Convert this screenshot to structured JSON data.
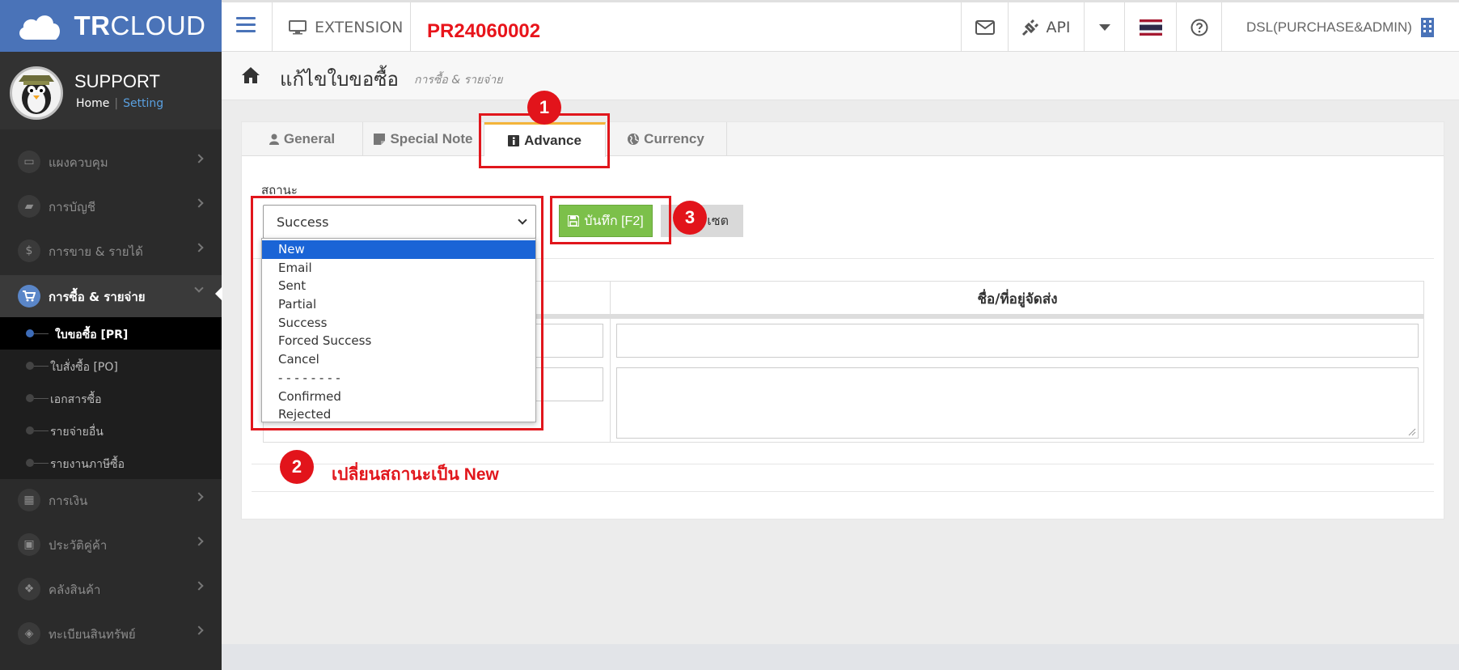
{
  "app": {
    "logo_text_bold": "TR",
    "logo_text": "CLOUD",
    "document_number": "PR24060002"
  },
  "topbar": {
    "extension_label": "EXTENSION",
    "api_label": "API",
    "user_label": "DSL(PURCHASE&ADMIN)"
  },
  "profile": {
    "name": "SUPPORT",
    "home_link": "Home",
    "separator": "|",
    "setting_link": "Setting"
  },
  "sidebar": {
    "items": [
      {
        "label": "แผงควบคุม"
      },
      {
        "label": "การบัญชี"
      },
      {
        "label": "การขาย & รายได้"
      },
      {
        "label": "การซื้อ & รายจ่าย"
      },
      {
        "label": "การเงิน"
      },
      {
        "label": "ประวัติคู่ค้า"
      },
      {
        "label": "คลังสินค้า"
      },
      {
        "label": "ทะเบียนสินทรัพย์"
      }
    ],
    "sub_items": [
      {
        "label": "ใบขอซื้อ [PR]"
      },
      {
        "label": "ใบสั่งซื้อ [PO]"
      },
      {
        "label": "เอกสารซื้อ"
      },
      {
        "label": "รายจ่ายอื่น"
      },
      {
        "label": "รายงานภาษีซื้อ"
      }
    ]
  },
  "page": {
    "title": "แก้ไขใบขอซื้อ",
    "subtitle": "การซื้อ & รายจ่าย"
  },
  "tabs": [
    {
      "label": "General"
    },
    {
      "label": "Special Note"
    },
    {
      "label": "Advance"
    },
    {
      "label": "Currency"
    }
  ],
  "form": {
    "status_label": "สถานะ",
    "status_value": "Success",
    "status_options": [
      "New",
      "Email",
      "Sent",
      "Partial",
      "Success",
      "Forced Success",
      "Cancel",
      "- - - - - - - -",
      "Confirmed",
      "Rejected"
    ],
    "save_button": "บันทึก [F2]",
    "reset_button": "เซต",
    "ship_header": "ชื่อ/ที่อยู่จัดส่ง"
  },
  "annotations": {
    "badge_1": "1",
    "badge_2": "2",
    "badge_3": "3",
    "note": "เปลี่ยนสถานะเป็น New"
  },
  "colors": {
    "brand_blue": "#4a73b8",
    "annotation_red": "#e1161c",
    "save_green": "#7cc04a",
    "active_tab_accent": "#f3b43a",
    "selected_option": "#1a64d6"
  }
}
